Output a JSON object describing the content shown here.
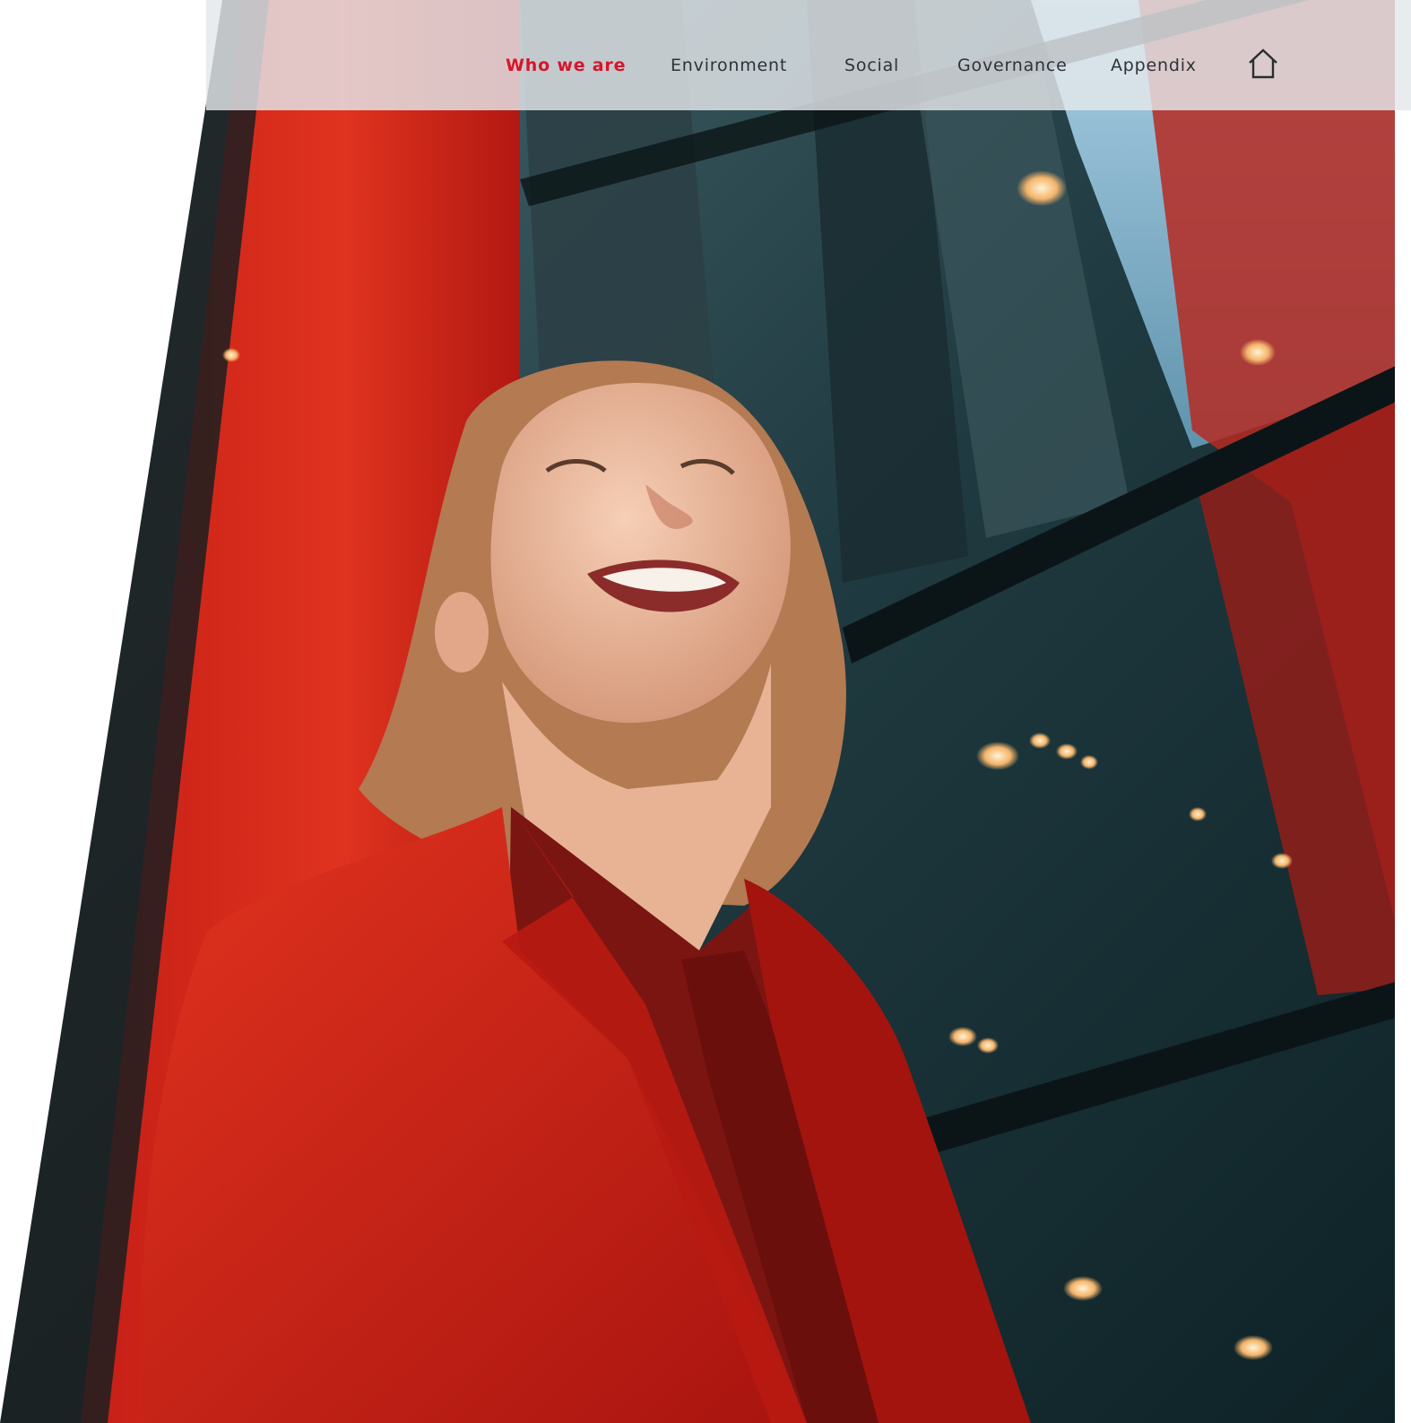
{
  "nav": {
    "items": [
      {
        "label": "Who we are",
        "active": true
      },
      {
        "label": "Environment",
        "active": false
      },
      {
        "label": "Social",
        "active": false
      },
      {
        "label": "Governance",
        "active": false
      },
      {
        "label": "Appendix",
        "active": false
      }
    ],
    "home_icon": "home-icon"
  },
  "colors": {
    "accent": "#d9142a",
    "nav_text": "#2f3236",
    "nav_bar": "#e4e8ec",
    "suit_red": "#c8201b"
  },
  "hero": {
    "image_subject": "woman-in-red-suit-looking-up"
  }
}
